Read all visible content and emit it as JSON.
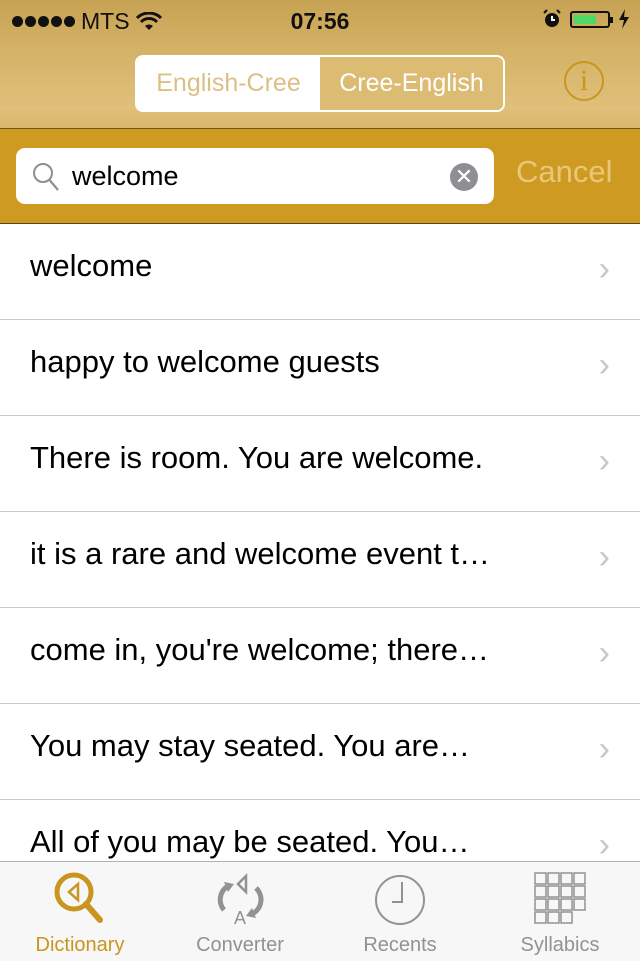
{
  "status_bar": {
    "carrier": "MTS",
    "time": "07:56",
    "battery_percent": 60
  },
  "header": {
    "segments": [
      {
        "label": "English-Cree",
        "selected": false
      },
      {
        "label": "Cree-English",
        "selected": true
      }
    ],
    "info_label": "i"
  },
  "search": {
    "value": "welcome",
    "placeholder": "Search",
    "cancel_label": "Cancel"
  },
  "results": [
    {
      "text": "welcome"
    },
    {
      "text": "happy to welcome guests"
    },
    {
      "text": "There is room.  You are welcome."
    },
    {
      "text": "it is a rare and welcome event t…"
    },
    {
      "text": "come in, you're welcome; there…"
    },
    {
      "text": "You may stay seated.  You are…"
    },
    {
      "text": "All of you may be seated.  You…"
    }
  ],
  "tabs": [
    {
      "label": "Dictionary",
      "icon": "dictionary-search-icon",
      "active": true
    },
    {
      "label": "Converter",
      "icon": "converter-icon",
      "active": false
    },
    {
      "label": "Recents",
      "icon": "clock-icon",
      "active": false
    },
    {
      "label": "Syllabics",
      "icon": "grid-icon",
      "active": false
    }
  ],
  "colors": {
    "accent": "#c8961e",
    "search_bar": "#cf9a22",
    "segment_selected": "#dcbc72"
  }
}
